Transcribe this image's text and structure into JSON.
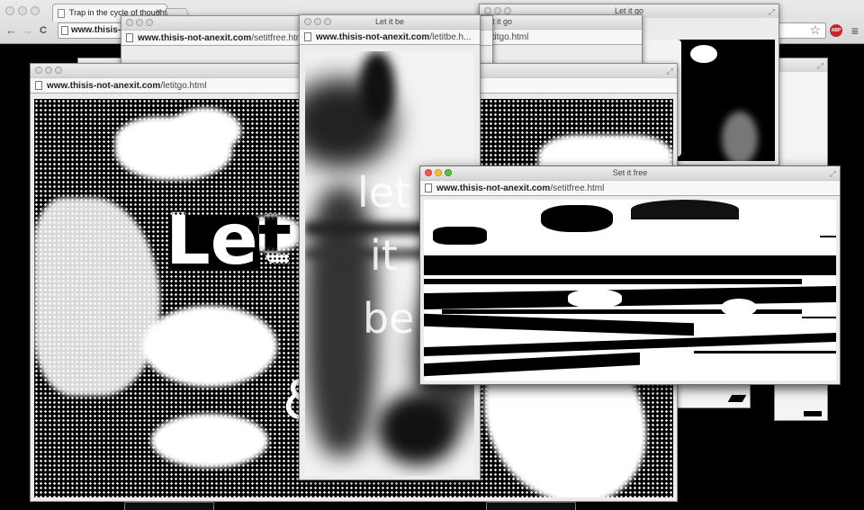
{
  "main_window": {
    "tab_title": "Trap in the cycle of thought",
    "tab_close": "×",
    "nav_back": "←",
    "nav_forward": "→",
    "nav_reload": "C",
    "url_domain": "www.thisis-",
    "star": "☆",
    "extension_badge": "ABP",
    "menu": "≡"
  },
  "windows": [
    {
      "id": "letitgo-back-right",
      "title": "Let it go",
      "url_domain": "",
      "url_path": ""
    },
    {
      "id": "letitgo-mid",
      "title": "Let it go",
      "url_domain": "",
      "url_path": "letitgo.html"
    },
    {
      "id": "setitfree-back",
      "title": "",
      "url_domain": "www.thisis-not-anexit.com",
      "url_path": "/setitfree.htm"
    },
    {
      "id": "letitgo-front-left",
      "title": "",
      "url_domain": "www.thisis-not-anexit.com",
      "url_path": "/letitgo.html"
    },
    {
      "id": "letitbe",
      "title": "Let it be",
      "url_domain": "www.thisis-not-anexit.com",
      "url_path": "/letitbe.h..."
    },
    {
      "id": "setitfree-front",
      "title": "Set it free",
      "url_domain": "www.thisis-not-anexit.com",
      "url_path": "/setitfree.html"
    }
  ],
  "overlay_text": {
    "letitgo_word": "Let",
    "letitgo_amp": "&",
    "letitbe_line1": "let",
    "letitbe_line2": "it",
    "letitbe_line3": "be"
  },
  "colors": {
    "close": "#f2574f",
    "minimize": "#f8bc2f",
    "zoom": "#55c33a",
    "abp_red": "#c8262d"
  }
}
